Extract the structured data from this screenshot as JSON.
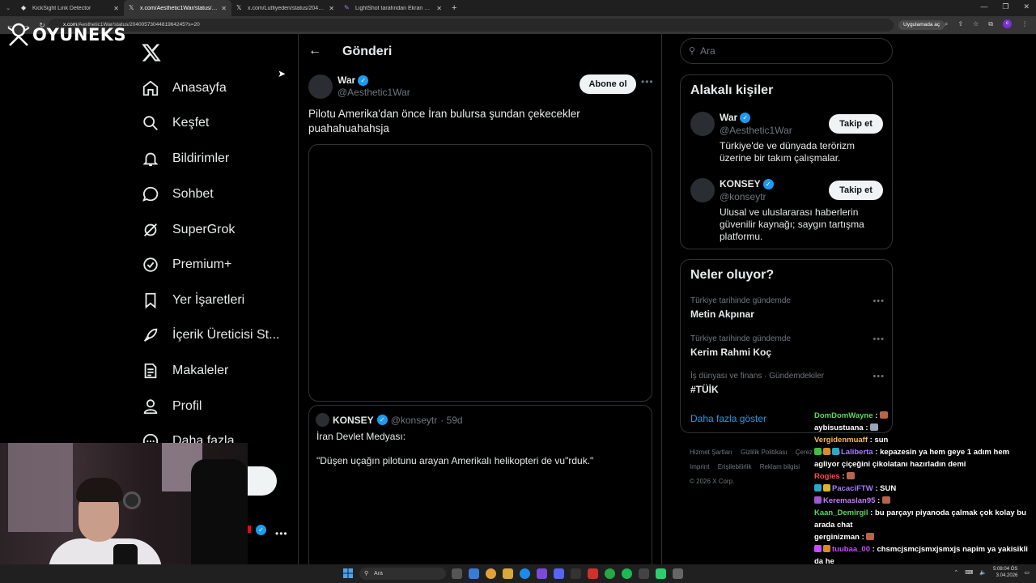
{
  "browser": {
    "tabs": [
      {
        "label": "KickSight Link Detector",
        "active": false
      },
      {
        "label": "x.com/Aesthetic1War/status/20…",
        "active": true
      },
      {
        "label": "x.com/Lutfiyeden/status/2040…",
        "active": false
      },
      {
        "label": "LightShot tarafından Ekran Gö…",
        "active": false
      }
    ],
    "url_host": "x.com",
    "url_path": "/Aesthetic1War/status/2040057304481964245?s=20",
    "open_app_label": "Uygulamada aç"
  },
  "overlay_logo": "OYUNEKS",
  "nav": {
    "items": [
      {
        "label": "Anasayfa",
        "icon": "home-icon"
      },
      {
        "label": "Keşfet",
        "icon": "search-icon"
      },
      {
        "label": "Bildirimler",
        "icon": "bell-icon"
      },
      {
        "label": "Sohbet",
        "icon": "chat-icon"
      },
      {
        "label": "SuperGrok",
        "icon": "grok-icon"
      },
      {
        "label": "Premium+",
        "icon": "verified-icon"
      },
      {
        "label": "Yer İşaretleri",
        "icon": "bookmark-icon"
      },
      {
        "label": "İçerik Üreticisi St...",
        "icon": "rocket-icon"
      },
      {
        "label": "Makaleler",
        "icon": "article-icon"
      },
      {
        "label": "Profil",
        "icon": "profile-icon"
      },
      {
        "label": "Daha fazla",
        "icon": "more-icon"
      }
    ]
  },
  "post": {
    "header_title": "Gönderi",
    "author_name": "War",
    "author_handle": "@Aesthetic1War",
    "follow_label": "Abone ol",
    "text": "Pilotu Amerika'dan önce İran bulursa şundan çekecekler puahahuahahsja",
    "quote": {
      "name": "KONSEY",
      "handle": "@konseytr",
      "age": "· 59d",
      "line1": "İran Devlet Medyası:",
      "line2": "\"Düşen uçağın pilotunu arayan Amerikalı helikopteri de vu\"rduk.\""
    }
  },
  "right": {
    "search_placeholder": "Ara",
    "related_title": "Alakalı kişiler",
    "people": [
      {
        "name": "War",
        "handle": "@Aesthetic1War",
        "bio": "Türkiye'de ve dünyada terörizm üzerine bir takım çalışmalar.",
        "follow": "Takip et"
      },
      {
        "name": "KONSEY",
        "handle": "@konseytr",
        "bio": "Ulusal ve uluslararası haberlerin güvenilir kaynağı; saygın tartışma platformu.",
        "follow": "Takip et"
      }
    ],
    "trends_title": "Neler oluyor?",
    "trends": [
      {
        "context": "Türkiye tarihinde gündemde",
        "name": "Metin Akpınar"
      },
      {
        "context": "Türkiye tarihinde gündemde",
        "name": "Kerim Rahmi Koç"
      },
      {
        "context": "İş dünyası ve finans · Gündemdekiler",
        "name": "#TÜİK"
      }
    ],
    "show_more": "Daha fazla göster",
    "footer": [
      "Hizmet Şartları",
      "Gizlilik Politikası",
      "Çerez Politikası",
      "Imprint",
      "Erişilebilirlik",
      "Reklam bilgisi",
      "© 2026 X Corp."
    ]
  },
  "chat": [
    {
      "user": "DomDomWayne",
      "color": "#5bd65b",
      "msg": ""
    },
    {
      "user": "aybisustuana",
      "color": "#ffffff",
      "msg": ""
    },
    {
      "user": "Vergidenmuaff",
      "color": "#ffb84d",
      "msg": "sun"
    },
    {
      "user": "Laliberta",
      "color": "#a77cff",
      "msg": "kepazesin ya hem geye 1 adım hem agliyor çiçeğini çikolatanı hazırladın demi"
    },
    {
      "user": "Rogies",
      "color": "#ff4d4d",
      "msg": ""
    },
    {
      "user": "PacaciFTW",
      "color": "#a77cff",
      "msg": "SUN"
    },
    {
      "user": "Keremaslan95",
      "color": "#c47cff",
      "msg": ""
    },
    {
      "user": "Kaan_Demirgil",
      "color": "#5bd65b",
      "msg": "bu parçayı piyanoda çalmak çok kolay bu arada chat"
    },
    {
      "user": "gerginizman",
      "color": "#ffffff",
      "msg": ""
    },
    {
      "user": "tuubaa_00",
      "color": "#c44dff",
      "msg": "chsmcjsmcjsmxjsmxjs napim ya yakisikli da he"
    }
  ],
  "taskbar": {
    "search_placeholder": "Ara",
    "time": "5:08:04 ÖS",
    "date": "3.04.2026"
  }
}
